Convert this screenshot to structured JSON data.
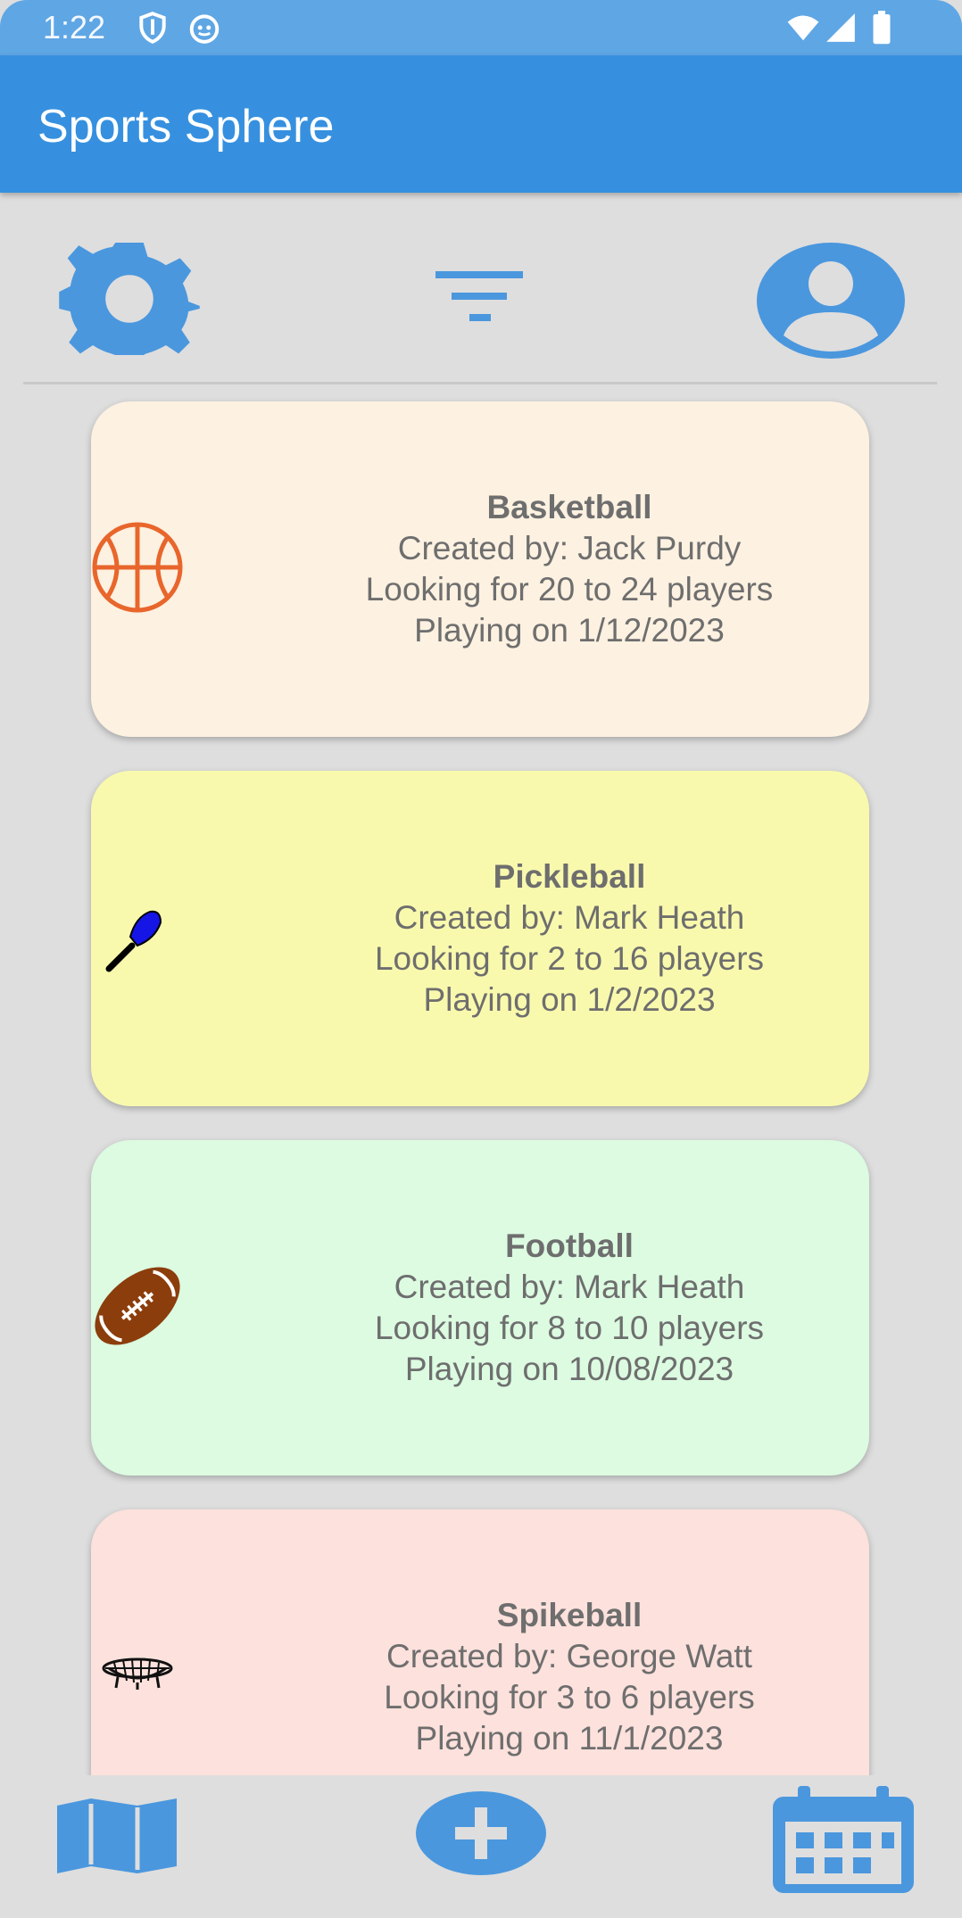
{
  "status": {
    "time": "1:22",
    "icons": [
      "shield-icon",
      "cat-face-icon",
      "wifi-icon",
      "signal-icon",
      "battery-icon"
    ]
  },
  "app": {
    "title": "Sports Sphere",
    "accent": "#3690df"
  },
  "toolbar": {
    "settings_icon": "gear-icon",
    "filter_icon": "filter-icon",
    "profile_icon": "account-icon"
  },
  "games": [
    {
      "sport": "Basketball",
      "created_by": "Created by: Jack Purdy",
      "players": "Looking for 20 to 24 players",
      "date": "Playing on 1/12/2023",
      "color": "#fdf1e1",
      "icon": "basketball-icon"
    },
    {
      "sport": "Pickleball",
      "created_by": "Created by: Mark Heath",
      "players": "Looking for 2 to 16 players",
      "date": "Playing on 1/2/2023",
      "color": "#f9f9ae",
      "icon": "pickleball-paddle-icon"
    },
    {
      "sport": "Football",
      "created_by": "Created by: Mark Heath",
      "players": "Looking for 8 to 10 players",
      "date": "Playing on 10/08/2023",
      "color": "#dcfbe1",
      "icon": "football-icon"
    },
    {
      "sport": "Spikeball",
      "created_by": "Created by: George Watt",
      "players": "Looking for 3 to 6 players",
      "date": "Playing on 11/1/2023",
      "color": "#fde1dc",
      "icon": "spikeball-net-icon"
    }
  ],
  "bottom_nav": {
    "map_icon": "map-icon",
    "add_icon": "add-icon",
    "calendar_icon": "calendar-icon"
  }
}
